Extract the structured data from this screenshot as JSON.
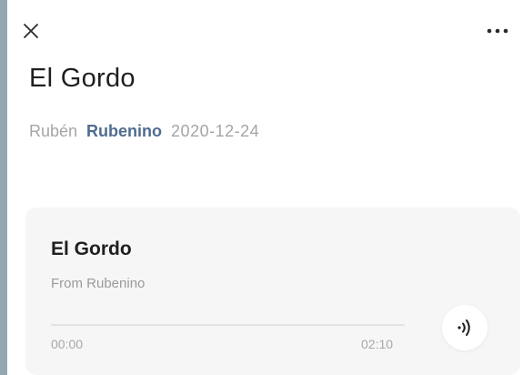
{
  "header": {
    "close_icon": "close-icon",
    "more_icon": "more-horizontal-icon"
  },
  "article": {
    "title": "El Gordo",
    "author": "Rubén",
    "account": "Rubenino",
    "date": "2020-12-24"
  },
  "audio": {
    "title": "El Gordo",
    "subtitle": "From Rubenino",
    "current_time": "00:00",
    "duration": "02:10",
    "progress": 0,
    "play_icon": "audio-wave-icon"
  },
  "colors": {
    "background": "#93a7b1",
    "accent": "#4f6c8f",
    "card": "#f6f6f6"
  }
}
